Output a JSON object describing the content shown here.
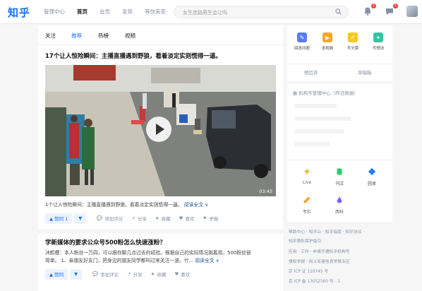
{
  "header": {
    "logo": "知乎",
    "nav": [
      {
        "label": "管理中心"
      },
      {
        "label": "首页"
      },
      {
        "label": "会员"
      },
      {
        "label": "发现"
      },
      {
        "label": "等你来答"
      }
    ],
    "search_placeholder": "女生走路男生会让吗",
    "notif_count": "1",
    "msg_count": "1"
  },
  "feed": {
    "tabs": [
      "关注",
      "推荐",
      "热榜",
      "视频"
    ],
    "post1": {
      "title": "17个让人惊险瞬间：主播直播遇到野狼，看着淡定实则慌得一逼。",
      "duration": "03:43",
      "excerpt": "1个让人惊险瞬间：主播直播遇到野狼，看着淡定实则慌得一逼。",
      "more": "阅读全文 ∨",
      "vote": "▲ 赞同 1",
      "actions": [
        "添加评论",
        "分享",
        "收藏",
        "喜欢",
        "举报"
      ]
    },
    "post2": {
      "title": "学新媒体的要求公众号500粉怎么快速涨粉？",
      "excerpt1": "沐鹤樱：本人粉丝一万四，可以跟你聊几点过去的经验。根据自己的实际情况挑着用，500粉丝很",
      "excerpt2": "简单。 1、亲朋友好友门，把身边的朋友同学都叫过来关注一波。什...",
      "more": "阅读全文 ∨",
      "vote": "▲ 赞同",
      "actions": [
        "添加评论",
        "分享",
        "收藏",
        "喜欢"
      ]
    }
  },
  "sidebar": {
    "create": {
      "items": [
        {
          "label": "回答问题",
          "icon": "pen-icon",
          "color": "#5b7bf5"
        },
        {
          "label": "发视频",
          "icon": "camera-icon",
          "color": "#f5a623"
        },
        {
          "label": "写文章",
          "icon": "edit-icon",
          "color": "#f8c81c"
        },
        {
          "label": "写想法",
          "icon": "bulb-icon",
          "color": "#35c4a3"
        }
      ],
      "links": [
        "稍后答",
        "草稿箱"
      ]
    },
    "org": {
      "title": "机构号管理中心（昨日数据）",
      "rows": [
        "—",
        "—",
        "—",
        "—"
      ]
    },
    "services": {
      "items": [
        {
          "label": "Live",
          "icon": "lightning-icon",
          "color": "#f8b21c"
        },
        {
          "label": "书店",
          "icon": "book-icon",
          "color": "#2ecc71"
        },
        {
          "label": "圆桌",
          "icon": "flower-icon",
          "color": "#1772f6"
        },
        {
          "label": "专栏",
          "icon": "pen-icon",
          "color": "#f5a623"
        },
        {
          "label": "西科",
          "icon": "drop-icon",
          "color": "#7b61ff"
        }
      ]
    },
    "footer": [
      "帮助中心 · 知乎山 · 知乎指南 · 知乎协议 ·",
      "知乎隐私保护指引",
      "应用 · 工作 · 申请开通知乎机构号",
      "侵权举报 · 网上有害信息举报专区",
      "京 ICP 证 110745 号",
      "京 ICP 备 13052560 号 - 1"
    ]
  }
}
